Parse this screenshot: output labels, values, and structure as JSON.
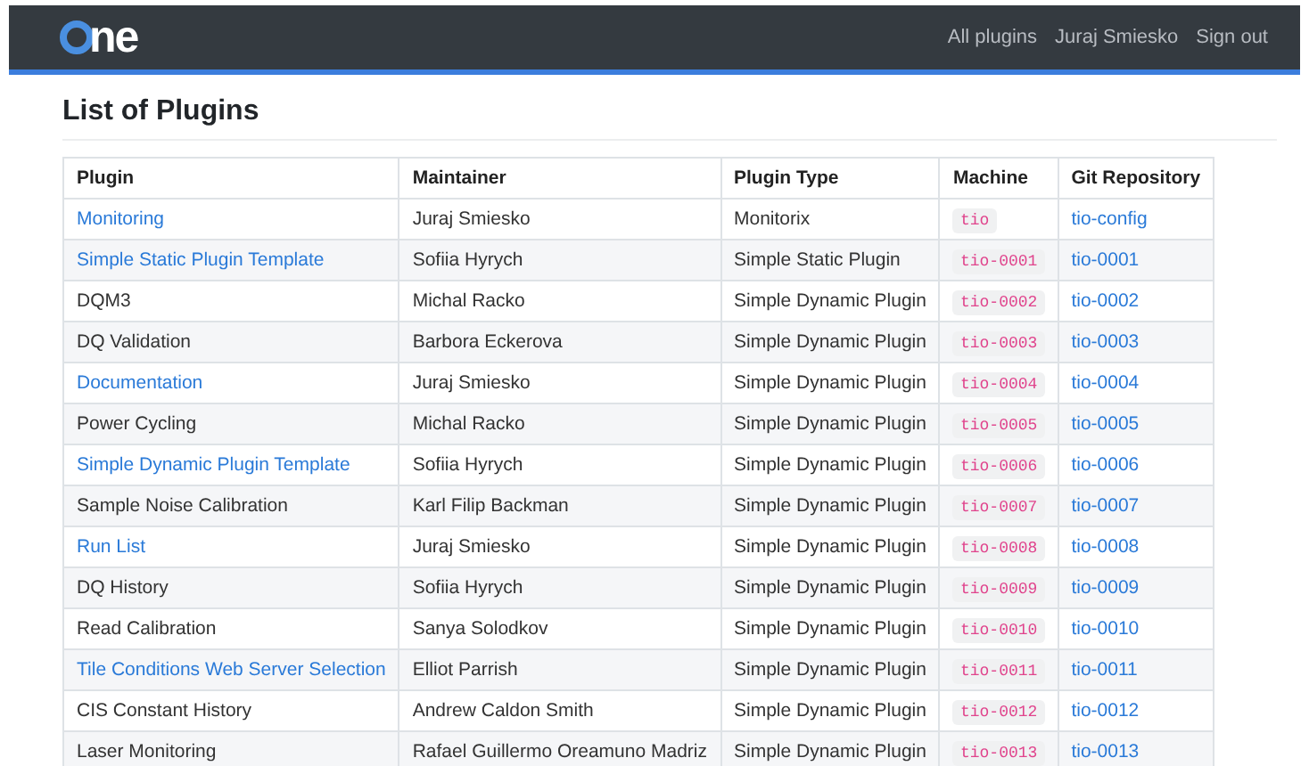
{
  "navbar": {
    "logo_text": "ne",
    "links": [
      "All plugins",
      "Juraj Smiesko",
      "Sign out"
    ]
  },
  "heading": "List of Plugins",
  "table": {
    "columns": [
      "Plugin",
      "Maintainer",
      "Plugin Type",
      "Machine",
      "Git Repository"
    ],
    "rows": [
      {
        "plugin": "Monitoring",
        "link": true,
        "maintainer": "Juraj Smiesko",
        "type": "Monitorix",
        "machine": "tio",
        "repo": "tio-config"
      },
      {
        "plugin": "Simple Static Plugin Template",
        "link": true,
        "maintainer": "Sofiia Hyrych",
        "type": "Simple Static Plugin",
        "machine": "tio-0001",
        "repo": "tio-0001"
      },
      {
        "plugin": "DQM3",
        "link": false,
        "maintainer": "Michal Racko",
        "type": "Simple Dynamic Plugin",
        "machine": "tio-0002",
        "repo": "tio-0002"
      },
      {
        "plugin": "DQ Validation",
        "link": false,
        "maintainer": "Barbora Eckerova",
        "type": "Simple Dynamic Plugin",
        "machine": "tio-0003",
        "repo": "tio-0003"
      },
      {
        "plugin": "Documentation",
        "link": true,
        "maintainer": "Juraj Smiesko",
        "type": "Simple Dynamic Plugin",
        "machine": "tio-0004",
        "repo": "tio-0004"
      },
      {
        "plugin": "Power Cycling",
        "link": false,
        "maintainer": "Michal Racko",
        "type": "Simple Dynamic Plugin",
        "machine": "tio-0005",
        "repo": "tio-0005"
      },
      {
        "plugin": "Simple Dynamic Plugin Template",
        "link": true,
        "maintainer": "Sofiia Hyrych",
        "type": "Simple Dynamic Plugin",
        "machine": "tio-0006",
        "repo": "tio-0006"
      },
      {
        "plugin": "Sample Noise Calibration",
        "link": false,
        "maintainer": "Karl Filip Backman",
        "type": "Simple Dynamic Plugin",
        "machine": "tio-0007",
        "repo": "tio-0007"
      },
      {
        "plugin": "Run List",
        "link": true,
        "maintainer": "Juraj Smiesko",
        "type": "Simple Dynamic Plugin",
        "machine": "tio-0008",
        "repo": "tio-0008"
      },
      {
        "plugin": "DQ History",
        "link": false,
        "maintainer": "Sofiia Hyrych",
        "type": "Simple Dynamic Plugin",
        "machine": "tio-0009",
        "repo": "tio-0009"
      },
      {
        "plugin": "Read Calibration",
        "link": false,
        "maintainer": "Sanya Solodkov",
        "type": "Simple Dynamic Plugin",
        "machine": "tio-0010",
        "repo": "tio-0010"
      },
      {
        "plugin": "Tile Conditions Web Server Selection",
        "link": true,
        "maintainer": "Elliot Parrish",
        "type": "Simple Dynamic Plugin",
        "machine": "tio-0011",
        "repo": "tio-0011"
      },
      {
        "plugin": "CIS Constant History",
        "link": false,
        "maintainer": "Andrew Caldon Smith",
        "type": "Simple Dynamic Plugin",
        "machine": "tio-0012",
        "repo": "tio-0012"
      },
      {
        "plugin": "Laser Monitoring",
        "link": false,
        "maintainer": "Rafael Guillermo Oreamuno Madriz",
        "type": "Simple Dynamic Plugin",
        "machine": "tio-0013",
        "repo": "tio-0013"
      }
    ]
  }
}
